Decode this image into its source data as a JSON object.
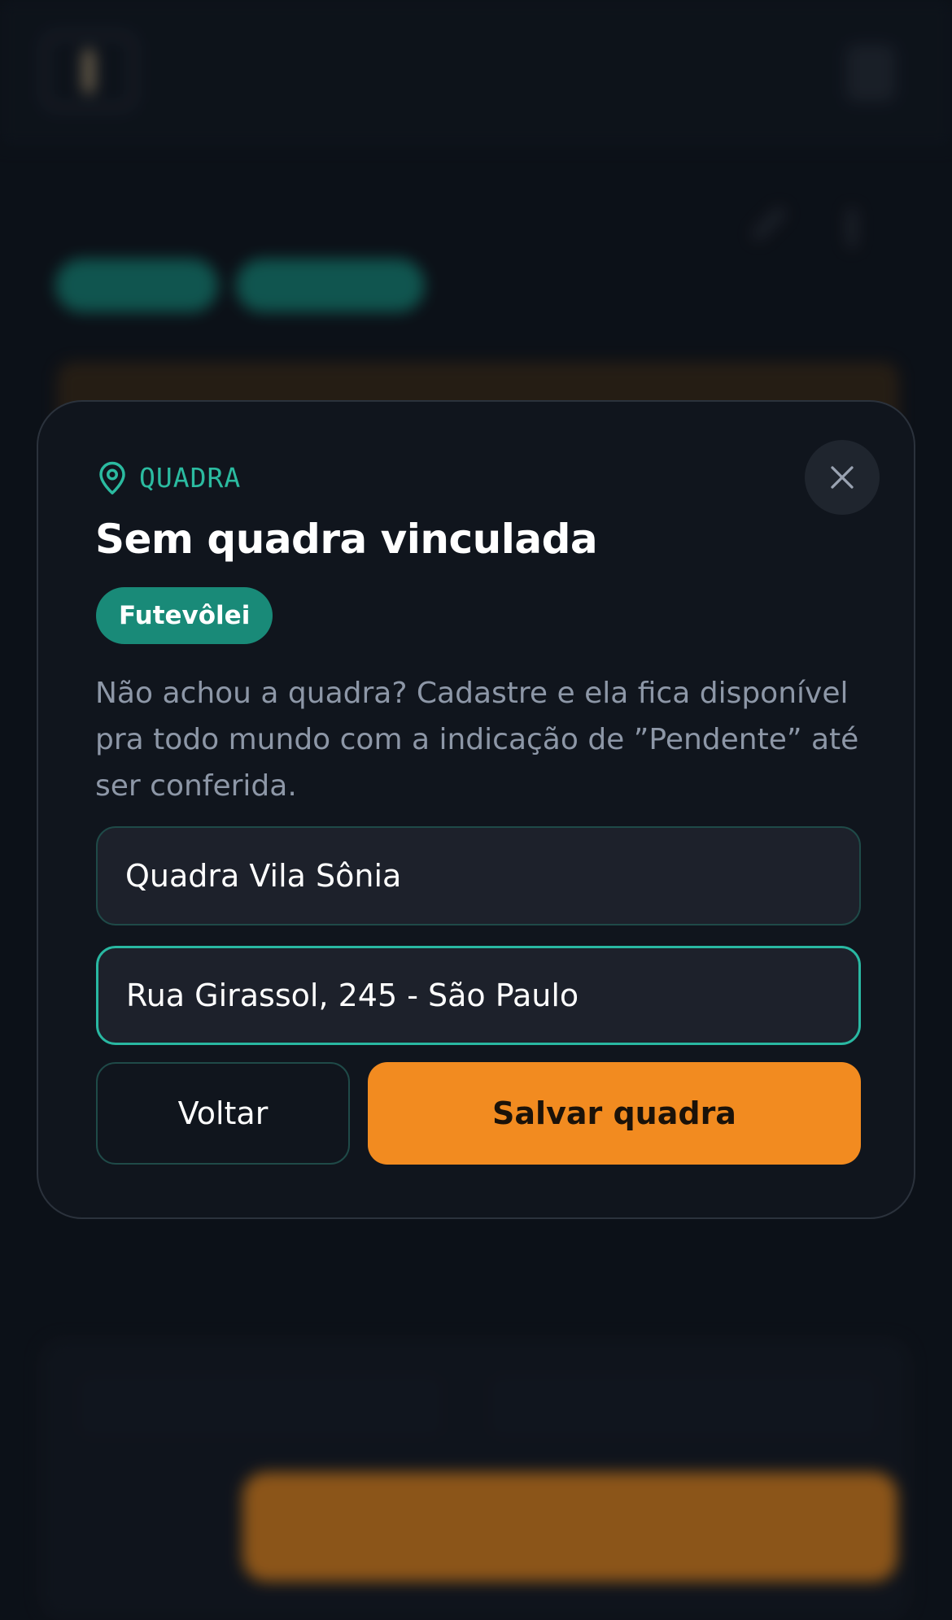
{
  "background": {
    "app_name": "",
    "page_title": "",
    "pills": [
      "",
      ""
    ],
    "tabs": [
      "",
      ""
    ],
    "back_label": "",
    "cta_label": ""
  },
  "modal": {
    "section_label": "QUADRA",
    "section_icon": "map-pin-icon",
    "title": "Sem quadra vinculada",
    "sport_badge": "Futevôlei",
    "help_text": "Não achou a quadra? Cadastre e ela fica disponível pra todo mundo com a indicação de ”Pendente” até ser conferida.",
    "court_name_value": "Quadra Vila Sônia",
    "court_address_value": "Rua Girassol, 245 - São Paulo",
    "back_button": "Voltar",
    "save_button": "Salvar quadra",
    "close_icon": "close-icon"
  },
  "colors": {
    "accent_teal": "#2bbba0",
    "badge_teal": "#198a78",
    "primary_orange": "#f28b20",
    "background": "#0f141c"
  }
}
